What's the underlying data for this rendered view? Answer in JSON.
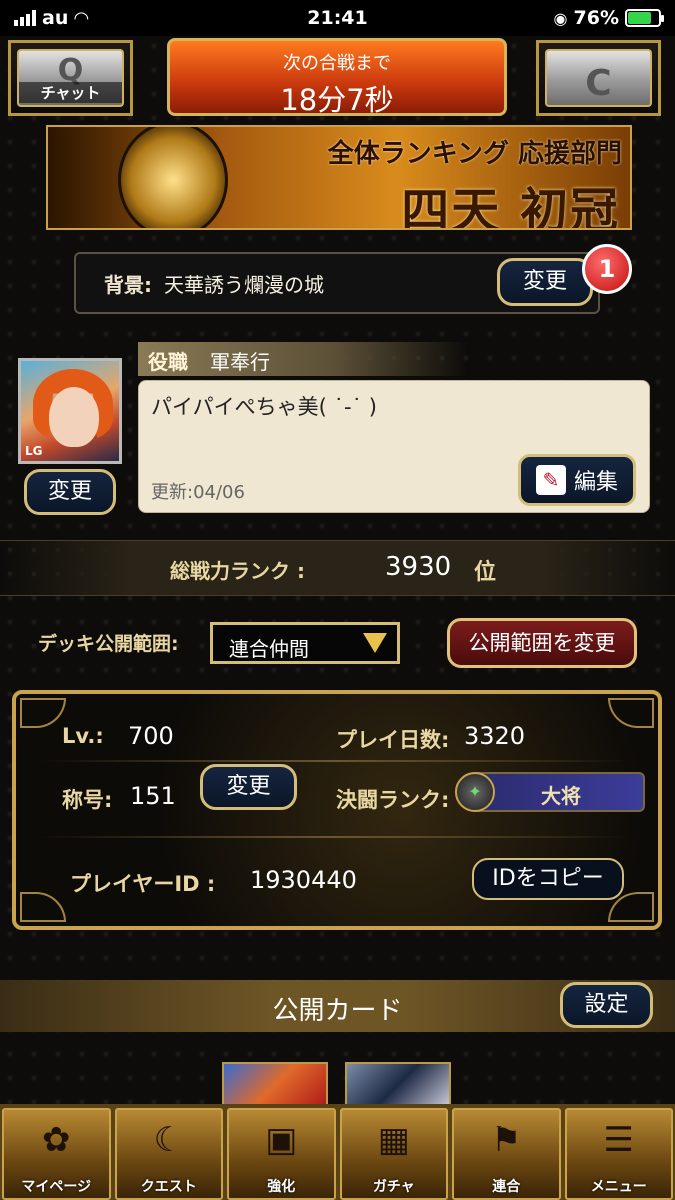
{
  "status_bar": {
    "carrier": "au",
    "time": "21:41",
    "battery": "76%"
  },
  "header": {
    "chat_label": "チャット",
    "countdown_caption": "次の合戦まで",
    "countdown_value": "18分7秒"
  },
  "ranking_banner": {
    "line1": "全体ランキング 応援部門",
    "line2": "四天 初冠"
  },
  "background": {
    "label": "背景:",
    "value": "天華誘う爛漫の城",
    "change_label": "変更",
    "badge_count": "1"
  },
  "profile": {
    "avatar_tag": "LG",
    "avatar_change_label": "変更",
    "role_label": "役職",
    "role_value": "軍奉行",
    "message": "パイパイぺちゃ美( ˙-˙ )",
    "updated": "更新:04/06",
    "edit_label": "編集"
  },
  "rank": {
    "label": "総戦力ランク :",
    "value": "3930",
    "unit": "位"
  },
  "deck": {
    "label": "デッキ公開範囲:",
    "selected": "連合仲間",
    "change_scope_label": "公開範囲を変更"
  },
  "stats": {
    "level_label": "Lv.:",
    "level_value": "700",
    "play_days_label": "プレイ日数:",
    "play_days_value": "3320",
    "title_label": "称号:",
    "title_value": "151",
    "title_change_label": "変更",
    "duel_rank_label": "決闘ランク:",
    "duel_rank_value": "大将",
    "player_id_label": "プレイヤーID :",
    "player_id_value": "1930440",
    "copy_id_label": "IDをコピー"
  },
  "public_cards": {
    "title": "公開カード",
    "settings_label": "設定"
  },
  "nav": [
    {
      "label": "マイページ",
      "icon": "fan-icon"
    },
    {
      "label": "クエスト",
      "icon": "scythe-icon"
    },
    {
      "label": "強化",
      "icon": "cards-icon"
    },
    {
      "label": "ガチャ",
      "icon": "screen-icon"
    },
    {
      "label": "連合",
      "icon": "flags-icon"
    },
    {
      "label": "メニュー",
      "icon": "menu-icon"
    }
  ],
  "colors": {
    "accent_gold": "#d4bd79",
    "countdown_orange": "#c9380d",
    "badge_red": "#c10f0f",
    "button_navy": "#0b1628"
  }
}
